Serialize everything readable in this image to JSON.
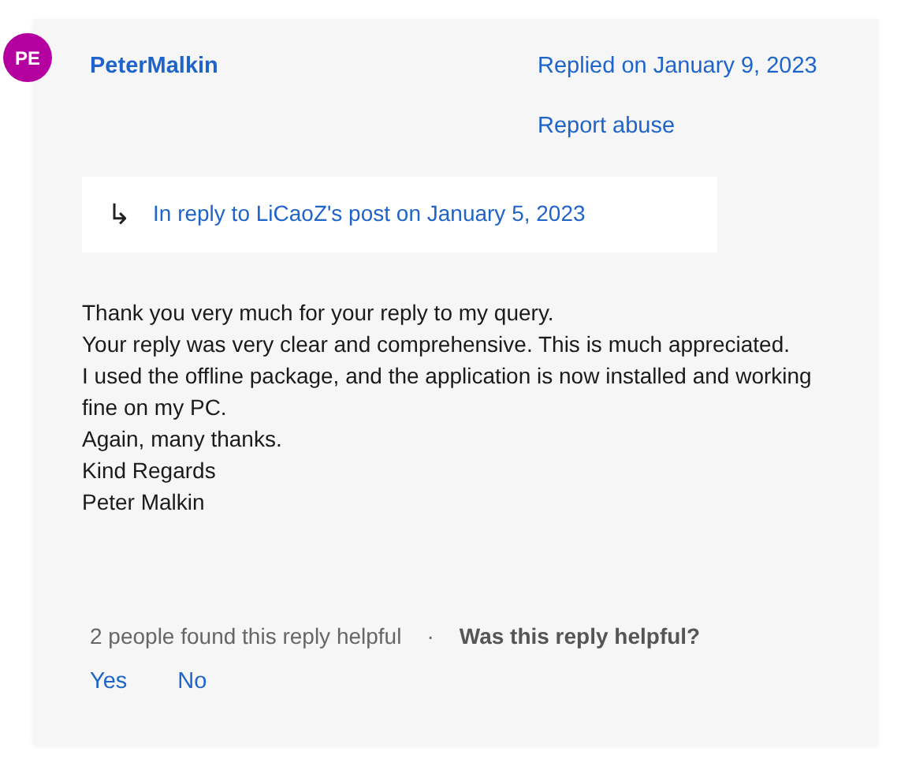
{
  "post": {
    "avatar": {
      "initials": "PE",
      "color": "#b4009e"
    },
    "author": "PeterMalkin",
    "replied": "Replied on January 9, 2023",
    "report": "Report abuse",
    "in_reply": {
      "arrow": "↳",
      "text": "In reply to LiCaoZ's post on January 5, 2023"
    },
    "body": [
      "Thank you very much for your reply to my query.",
      "Your reply was very clear and comprehensive.  This is much appreciated.",
      "I used the offline package, and the application is now installed and working fine on my PC.",
      "Again, many thanks.",
      "Kind Regards",
      "Peter Malkin"
    ],
    "helpful_count": "2 people found this reply helpful",
    "separator": "·",
    "question": "Was this reply helpful?",
    "votes": [
      "Yes",
      "No"
    ]
  }
}
